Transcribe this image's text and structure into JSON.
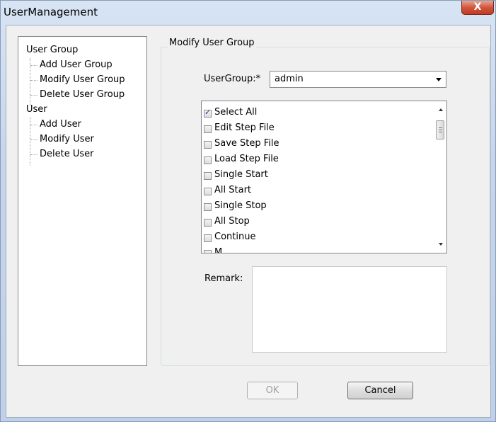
{
  "window": {
    "title": "UserManagement",
    "close_glyph": "X"
  },
  "tree": {
    "groups": [
      {
        "label": "User Group",
        "children": [
          "Add User Group",
          "Modify User Group",
          "Delete User Group"
        ]
      },
      {
        "label": "User",
        "children": [
          "Add User",
          "Modify User",
          "Delete User"
        ]
      }
    ]
  },
  "panel": {
    "title": "Modify User Group",
    "usergroup_label": "UserGroup:",
    "required_mark": "*",
    "usergroup_value": "admin",
    "permissions": [
      {
        "label": "Select All",
        "checked": true
      },
      {
        "label": "Edit Step File",
        "checked": false
      },
      {
        "label": "Save Step File",
        "checked": false
      },
      {
        "label": "Load Step File",
        "checked": false
      },
      {
        "label": "Single Start",
        "checked": false
      },
      {
        "label": "All Start",
        "checked": false
      },
      {
        "label": "Single Stop",
        "checked": false
      },
      {
        "label": "All Stop",
        "checked": false
      },
      {
        "label": "Continue",
        "checked": false
      },
      {
        "label": "M...",
        "checked": false
      }
    ],
    "remark_label": "Remark:",
    "remark_value": ""
  },
  "buttons": {
    "ok": "OK",
    "ok_enabled": false,
    "cancel": "Cancel"
  }
}
